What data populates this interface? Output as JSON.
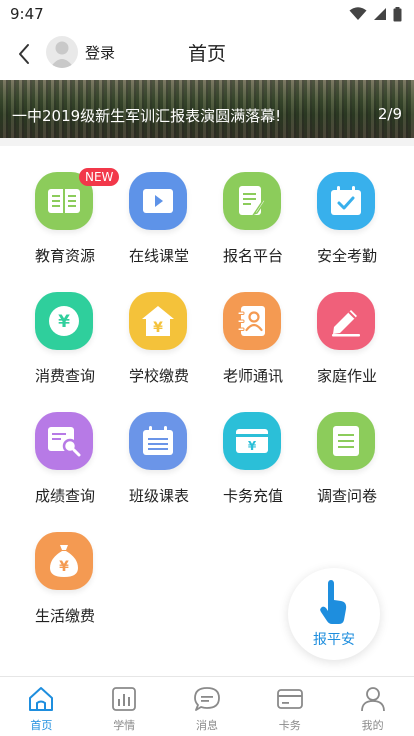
{
  "status_bar": {
    "time": "9:47"
  },
  "header": {
    "login_label": "登录",
    "title": "首页"
  },
  "banner": {
    "caption": "一中2019级新生军训汇报表演圆满落幕!",
    "page_indicator": "2/9"
  },
  "grid": {
    "badge_new": "NEW",
    "items": [
      {
        "label": "教育资源",
        "icon": "book-icon",
        "color": "#8ccc5b"
      },
      {
        "label": "在线课堂",
        "icon": "video-play-icon",
        "color": "#5e93e8"
      },
      {
        "label": "报名平台",
        "icon": "edit-form-icon",
        "color": "#8ccc5b"
      },
      {
        "label": "安全考勤",
        "icon": "calendar-check-icon",
        "color": "#38b0ec"
      },
      {
        "label": "消费查询",
        "icon": "yuan-coin-icon",
        "color": "#2fcf9c"
      },
      {
        "label": "学校缴费",
        "icon": "school-fee-icon",
        "color": "#f4c23a"
      },
      {
        "label": "老师通讯",
        "icon": "contact-book-icon",
        "color": "#f49a52"
      },
      {
        "label": "家庭作业",
        "icon": "pencil-icon",
        "color": "#f0607a"
      },
      {
        "label": "成绩查询",
        "icon": "report-search-icon",
        "color": "#b77ae6"
      },
      {
        "label": "班级课表",
        "icon": "schedule-icon",
        "color": "#6b95e8"
      },
      {
        "label": "卡务充值",
        "icon": "card-recharge-icon",
        "color": "#2bbfd8"
      },
      {
        "label": "调查问卷",
        "icon": "questionnaire-icon",
        "color": "#8ccc5b"
      },
      {
        "label": "生活缴费",
        "icon": "money-bag-icon",
        "color": "#f49a52"
      }
    ]
  },
  "float_button": {
    "label": "报平安",
    "icon": "tap-hand-icon",
    "color": "#1e8ede"
  },
  "bottom_nav": {
    "items": [
      {
        "label": "首页",
        "icon": "home-icon",
        "active": true
      },
      {
        "label": "学情",
        "icon": "bar-chart-icon",
        "active": false
      },
      {
        "label": "消息",
        "icon": "message-icon",
        "active": false
      },
      {
        "label": "卡务",
        "icon": "card-icon",
        "active": false
      },
      {
        "label": "我的",
        "icon": "user-icon",
        "active": false
      }
    ]
  }
}
